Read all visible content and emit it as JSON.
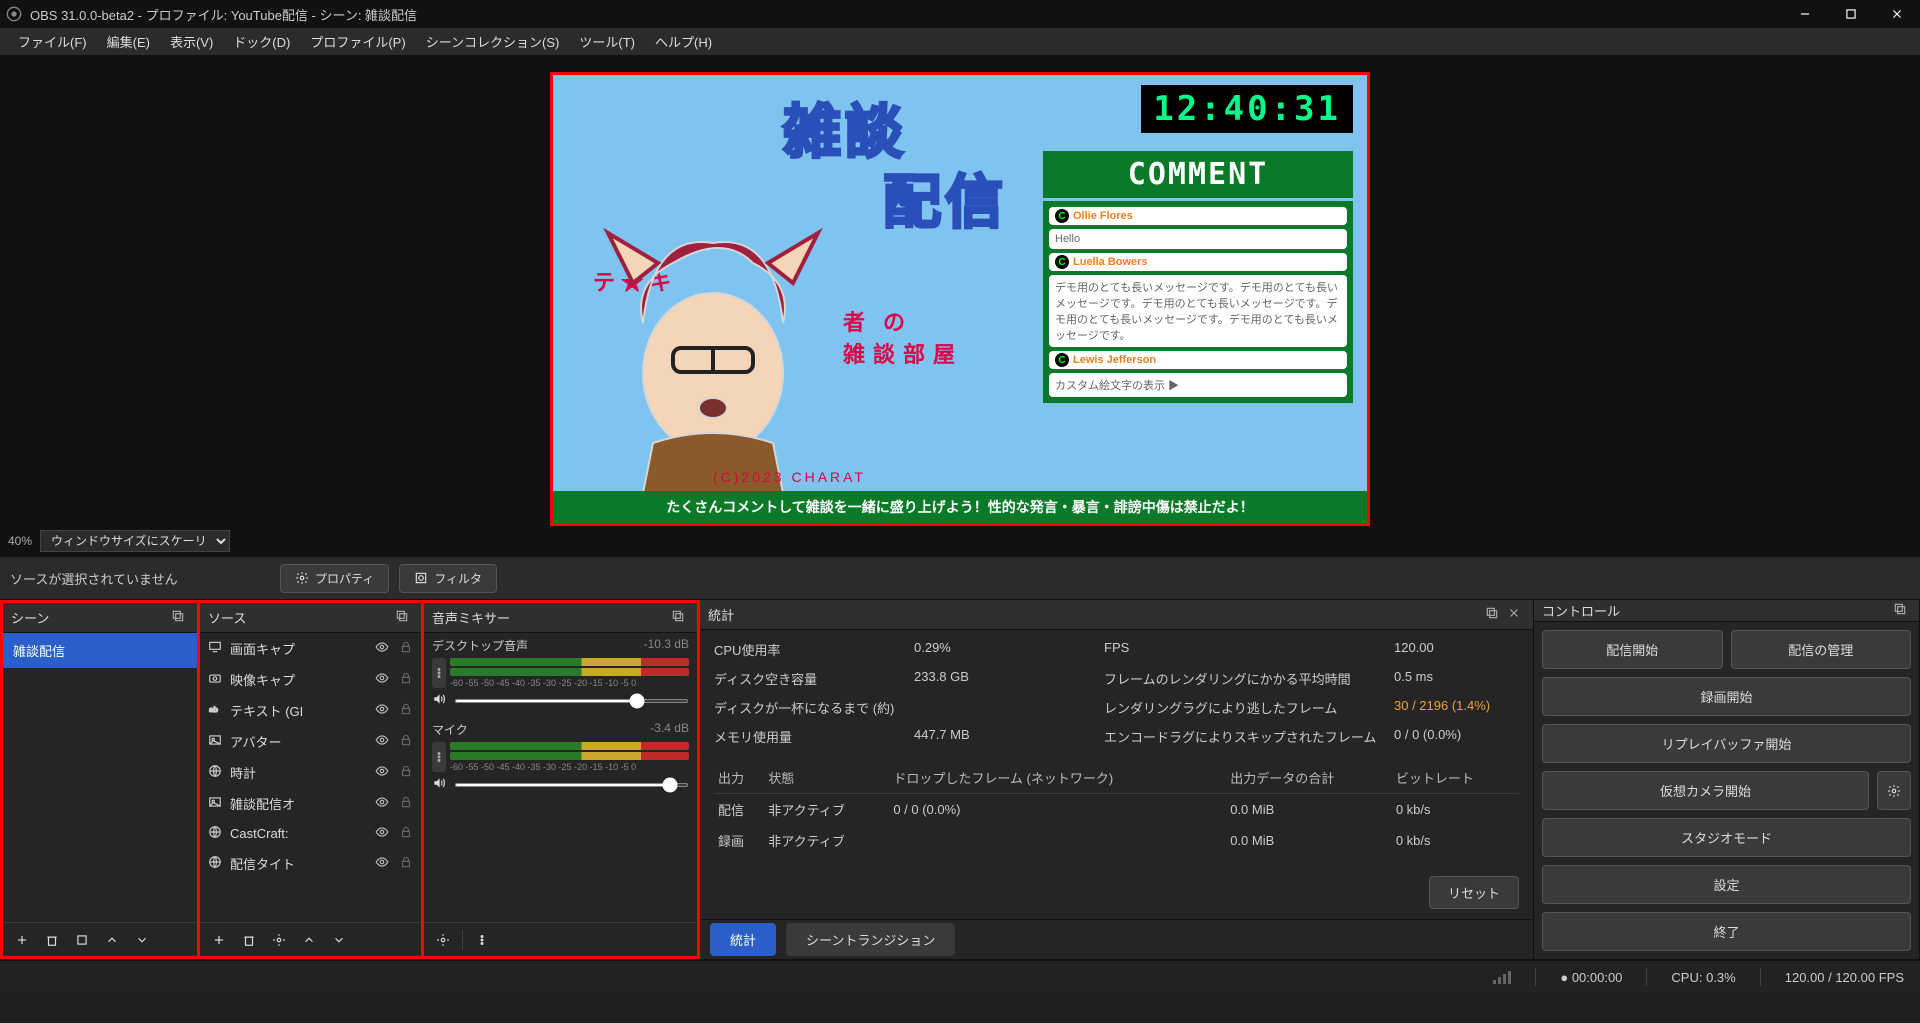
{
  "title": "OBS 31.0.0-beta2 - プロファイル: YouTube配信 - シーン: 雑談配信",
  "menus": [
    "ファイル(F)",
    "編集(E)",
    "表示(V)",
    "ドック(D)",
    "プロファイル(P)",
    "シーンコレクション(S)",
    "ツール(T)",
    "ヘルプ(H)"
  ],
  "preview": {
    "scale_label": "40%",
    "scale_mode": "ウィンドウサイズにスケーリング表示",
    "clock": "12:40:31",
    "title_art": "雑談",
    "title_art2": "配信",
    "comment_header": "COMMENT",
    "banner": "たくさんコメントして雑談を一緒に盛り上げよう！性的な発言・暴言・誹謗中傷は禁止だよ！",
    "subtitle": "テ ★ キ",
    "subtitle2": "者の",
    "subtitle3": "雑談部屋",
    "copyright": "(C)2023 CHARAT",
    "chats": [
      {
        "name": "Ollie Flores",
        "msg": "Hello"
      },
      {
        "name": "Luella Bowers",
        "msg": "デモ用のとても長いメッセージです。デモ用のとても長いメッセージです。デモ用のとても長いメッセージです。デモ用のとても長いメッセージです。デモ用のとても長いメッセージです。"
      },
      {
        "name": "Lewis Jefferson",
        "msg": "カスタム絵文字の表示 ▶"
      }
    ]
  },
  "src_sel": {
    "none_label": "ソースが選択されていません",
    "properties_btn": "プロパティ",
    "filters_btn": "フィルタ"
  },
  "scenes": {
    "header": "シーン",
    "items": [
      "雑談配信"
    ]
  },
  "sources": {
    "header": "ソース",
    "items": [
      {
        "icon": "monitor",
        "name": "画面キャプ"
      },
      {
        "icon": "camera",
        "name": "映像キャプ"
      },
      {
        "icon": "text",
        "name": "テキスト (GI"
      },
      {
        "icon": "image",
        "name": "アバター"
      },
      {
        "icon": "globe",
        "name": "時計"
      },
      {
        "icon": "image",
        "name": "雑談配信オ"
      },
      {
        "icon": "globe",
        "name": "CastCraft:"
      },
      {
        "icon": "globe",
        "name": "配信タイト"
      }
    ]
  },
  "mixer": {
    "header": "音声ミキサー",
    "channels": [
      {
        "name": "デスクトップ音声",
        "db": "-10.3 dB",
        "ticks": "-60 -55 -50 -45 -40 -35 -30 -25 -20 -15 -10 -5  0"
      },
      {
        "name": "マイク",
        "db": "-3.4 dB",
        "ticks": "-60 -55 -50 -45 -40 -35 -30 -25 -20 -15 -10 -5  0"
      }
    ]
  },
  "stats": {
    "header": "統計",
    "metrics": {
      "cpu_label": "CPU使用率",
      "cpu": "0.29%",
      "fps_label": "FPS",
      "fps": "120.00",
      "disk_free_label": "ディスク空き容量",
      "disk_free": "233.8 GB",
      "render_avg_label": "フレームのレンダリングにかかる平均時間",
      "render_avg": "0.5 ms",
      "disk_full_label": "ディスクが一杯になるまで (約)",
      "disk_full": "",
      "render_lag_label": "レンダリングラグにより逃したフレーム",
      "render_lag": "30 / 2196 (1.4%)",
      "mem_label": "メモリ使用量",
      "mem": "447.7 MB",
      "enc_skip_label": "エンコードラグによりスキップされたフレーム",
      "enc_skip": "0 / 0 (0.0%)"
    },
    "table": {
      "headers": [
        "出力",
        "状態",
        "ドロップしたフレーム (ネットワーク)",
        "出力データの合計",
        "ビットレート"
      ],
      "rows": [
        [
          "配信",
          "非アクティブ",
          "0 / 0 (0.0%)",
          "0.0 MiB",
          "0 kb/s"
        ],
        [
          "録画",
          "非アクティブ",
          "",
          "0.0 MiB",
          "0 kb/s"
        ]
      ]
    },
    "reset_btn": "リセット",
    "tabs": [
      "統計",
      "シーントランジション"
    ]
  },
  "controls": {
    "header": "コントロール",
    "start_stream": "配信開始",
    "manage_stream": "配信の管理",
    "start_record": "録画開始",
    "replay_buffer": "リプレイバッファ開始",
    "virtual_cam": "仮想カメラ開始",
    "studio_mode": "スタジオモード",
    "settings": "設定",
    "exit": "終了"
  },
  "statusbar": {
    "live": "00:00:00",
    "cpu": "CPU: 0.3%",
    "fps": "120.00 / 120.00 FPS"
  }
}
